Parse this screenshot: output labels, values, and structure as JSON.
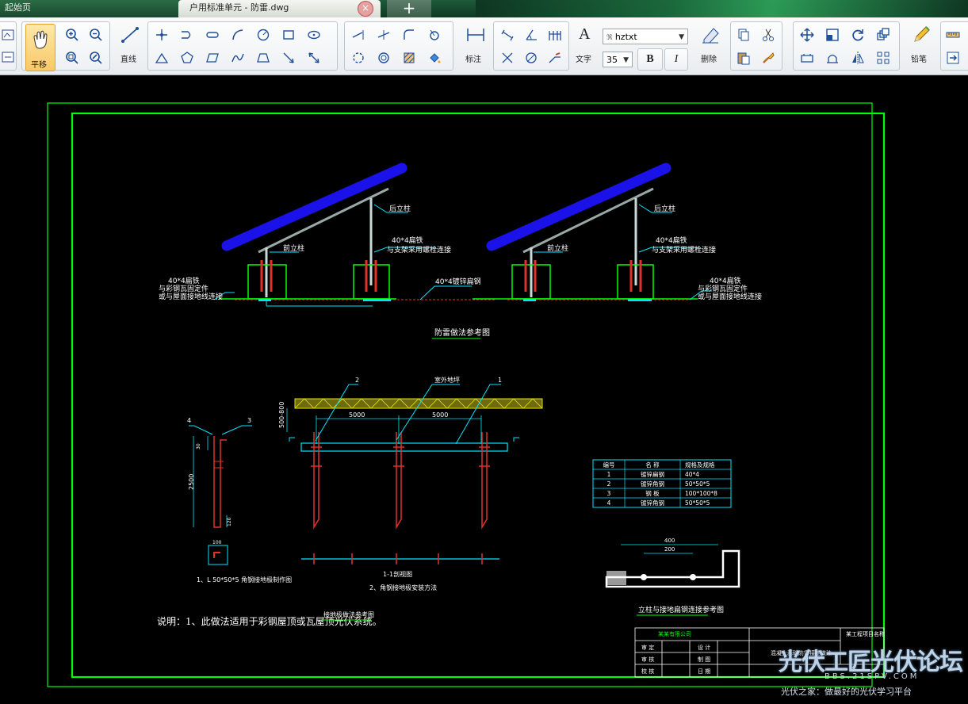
{
  "tabs": {
    "home": "起始页",
    "active": "户用标准单元 - 防雷.dwg",
    "close": "×",
    "new": "+"
  },
  "toolbar": {
    "pan_label": "平移",
    "line_label": "直线",
    "dimension_label": "标注",
    "text_label": "文字",
    "font_value": "hztxt",
    "font_size_value": "35",
    "bold": "B",
    "italic": "I",
    "delete_label": "删除",
    "pencil_label": "铅笔"
  },
  "drawing": {
    "label_rear_post": "后立柱",
    "label_front_post": "前立柱",
    "label_flat_steel_1": "40*4扁铁",
    "label_flat_steel_2": "与支架采用螺栓连接",
    "label_galv_flat": "40*4镀锌扁钢",
    "label_left_1": "40*4扁铁",
    "label_left_2": "与彩钢瓦固定件",
    "label_left_3": "或与屋面接地线连接",
    "section1_title": "防雷做法参考图",
    "ground_label": "室外地坪",
    "num1": "1",
    "num2": "2",
    "num3": "3",
    "num4": "4",
    "dim_5000a": "5000",
    "dim_5000b": "5000",
    "dim_500_800": "500-800",
    "dim_2500": "2500",
    "dim_100": "100",
    "dim_120": "120",
    "dim_30": "30",
    "note_steel": "1、L 50*50*5 角钢接地极制作图",
    "note_section": "1-1剖视图",
    "note_install": "2、角钢接地极安装方法",
    "note_main": "说明：1、此做法适用于彩钢屋顶或瓦屋顶光伏系统。",
    "section2_title": "接地极做法参考图",
    "connect_title": "立柱与接地扁钢连接参考图",
    "dim_400": "400",
    "dim_200": "200",
    "table": {
      "headers": [
        "编号",
        "名 称",
        "规格及规格"
      ],
      "rows": [
        [
          "1",
          "镀锌扁钢",
          "40*4"
        ],
        [
          "2",
          "镀锌角钢",
          "50*50*5"
        ],
        [
          "3",
          "钢 板",
          "100*100*8"
        ],
        [
          "4",
          "镀锌角钢",
          "50*50*5"
        ]
      ]
    },
    "titleblock": {
      "company": "某某有限公司",
      "drawing_name": "混凝土基础防雷接地做法",
      "project": "某工程项目名称",
      "row1a": "审 定",
      "row1b": "设 计",
      "row2a": "审 核",
      "row2b": "制 图",
      "row3a": "校 核",
      "row3b": "日 期"
    }
  },
  "watermark": {
    "logo": "光伏工匠光伏论坛",
    "url": "BBS.21SPV.COM",
    "slogan": "光伏之家：做最好的光伏学习平台"
  },
  "colors": {
    "frame": "#00ff00",
    "panel": "#1a12e8",
    "steel": "#e0322a",
    "cyan": "#00e5ff",
    "yellow": "#e8e000"
  }
}
